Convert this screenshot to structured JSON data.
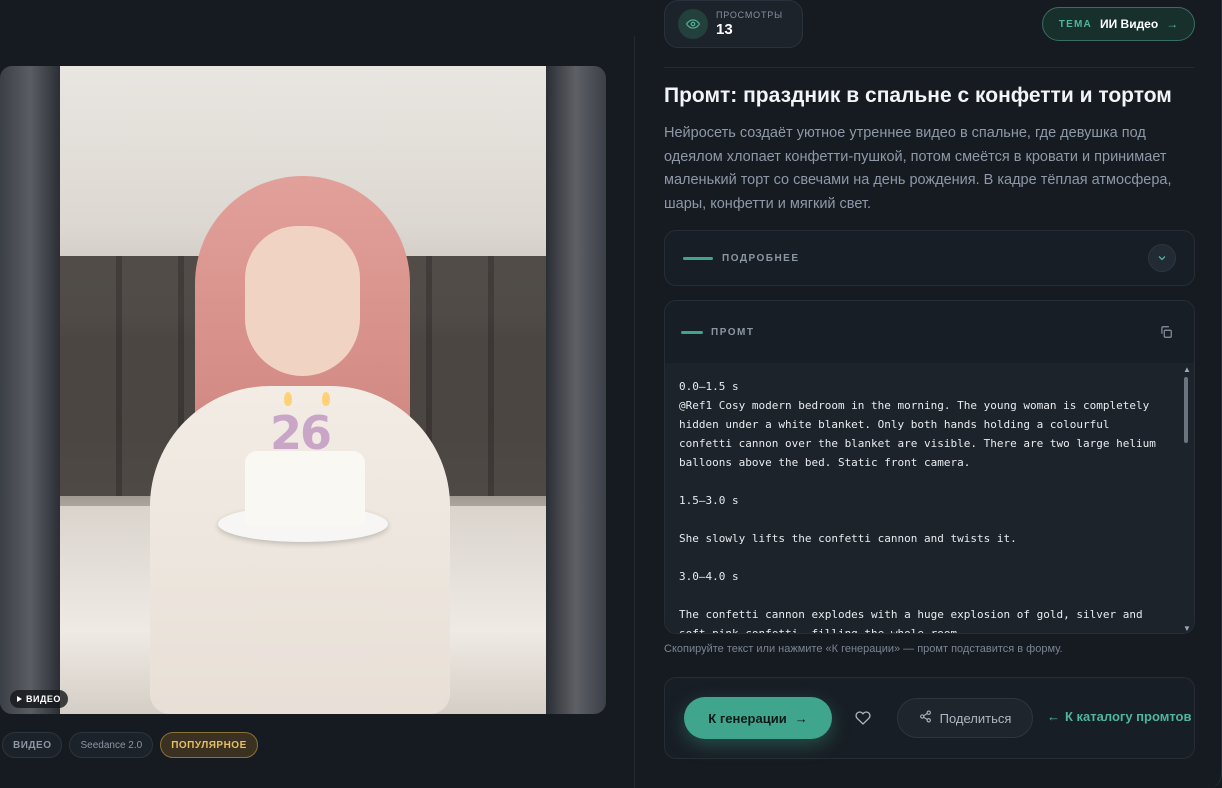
{
  "media": {
    "badge": "ВИДЕО",
    "candles": "26"
  },
  "chips": [
    "ВИДЕО",
    "Seedance 2.0",
    "ПОПУЛЯРНОЕ"
  ],
  "views": {
    "label": "ПРОСМОТРЫ",
    "count": "13"
  },
  "topic": {
    "key": "ТЕМА",
    "value": "ИИ Видео",
    "arrow": "→"
  },
  "title": "Промт: праздник в спальне с конфетти и тортом",
  "description": "Нейросеть создаёт уютное утреннее видео в спальне, где девушка под одеялом хлопает конфетти-пушкой, потом смеётся в кровати и принимает маленький торт со свечами на день рождения. В кадре тёплая атмосфера, шары, конфетти и мягкий свет.",
  "details": {
    "label": "ПОДРОБНЕЕ"
  },
  "prompt": {
    "label": "ПРОМТ",
    "text": "0.0–1.5 s\n@Ref1 Cosy modern bedroom in the morning. The young woman is completely hidden under a white blanket. Only both hands holding a colourful confetti cannon over the blanket are visible. There are two large helium balloons above the bed. Static front camera.\n\n1.5–3.0 s\n\nShe slowly lifts the confetti cannon and twists it.\n\n3.0–4.0 s\n\nThe confetti cannon explodes with a huge explosion of gold, silver and soft pink confetti, filling the whole room."
  },
  "hint": "Скопируйте текст или нажмите «К генерации» — промт подставится в форму.",
  "actions": {
    "generate": "К генерации",
    "generate_arrow": "→",
    "share": "Поделиться",
    "catalog_arrow": "←",
    "catalog": "К каталогу промтов"
  },
  "colors": {
    "accent": "#3fa58c",
    "background": "#161b22",
    "popular": "#e5bf6a"
  }
}
